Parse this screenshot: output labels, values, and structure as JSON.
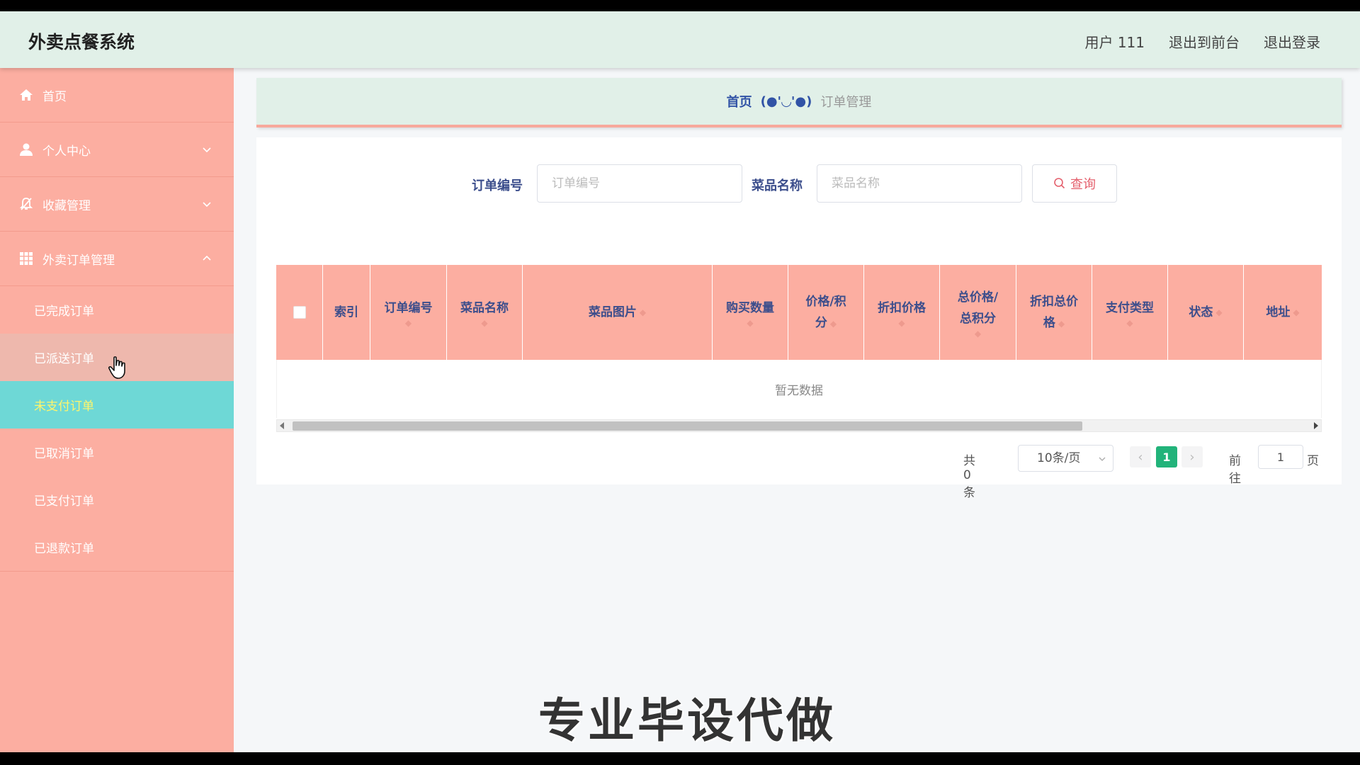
{
  "app": {
    "title": "外卖点餐系统"
  },
  "header": {
    "user_label": "用户 111",
    "to_frontend": "退出到前台",
    "logout": "退出登录"
  },
  "sidebar": {
    "items": [
      {
        "label": "首页",
        "icon": "home-icon"
      },
      {
        "label": "个人中心",
        "icon": "user-icon",
        "expanded": false
      },
      {
        "label": "收藏管理",
        "icon": "bell-off-icon",
        "expanded": false
      },
      {
        "label": "外卖订单管理",
        "icon": "grid-icon",
        "expanded": true
      }
    ],
    "submenu": [
      {
        "label": "已完成订单"
      },
      {
        "label": "已派送订单",
        "state": "hover"
      },
      {
        "label": "未支付订单",
        "state": "active"
      },
      {
        "label": "已取消订单"
      },
      {
        "label": "已支付订单"
      },
      {
        "label": "已退款订单"
      }
    ]
  },
  "breadcrumb": {
    "home": "首页",
    "separator": "(●'◡'●)",
    "current": "订单管理"
  },
  "search": {
    "order_no_label": "订单编号",
    "order_no_placeholder": "订单编号",
    "order_no_value": "",
    "dish_name_label": "菜品名称",
    "dish_name_placeholder": "菜品名称",
    "dish_name_value": "",
    "query_button": "查询"
  },
  "table": {
    "columns": {
      "index": "索引",
      "order_no": "订单编号",
      "dish_name": "菜品名称",
      "dish_image": "菜品图片",
      "quantity": "购买数量",
      "price_l1": "价格/积",
      "price_l2": "分",
      "discount_price": "折扣价格",
      "total_l1": "总价格/",
      "total_l2": "总积分",
      "discount_total_l1": "折扣总价",
      "discount_total_l2": "格",
      "pay_type": "支付类型",
      "status": "状态",
      "address": "地址"
    },
    "rows": [],
    "empty_text": "暂无数据",
    "scroll_position": 0.78
  },
  "pagination": {
    "total_text": "共 0 条",
    "page_size": "10条/页",
    "current_page": "1",
    "goto_label": "前往",
    "goto_value": "1",
    "goto_unit": "页"
  },
  "watermark": "专业毕设代做",
  "colors": {
    "header_bg": "#e1f0e8",
    "sidebar_bg": "#fcaea1",
    "active_item_bg": "#6ed8d6",
    "active_item_text": "#fff56b",
    "table_header_bg": "#fcaea1",
    "table_header_text": "#3c4e8c",
    "pager_active": "#22b37a",
    "query_button_text": "#e4606d"
  }
}
